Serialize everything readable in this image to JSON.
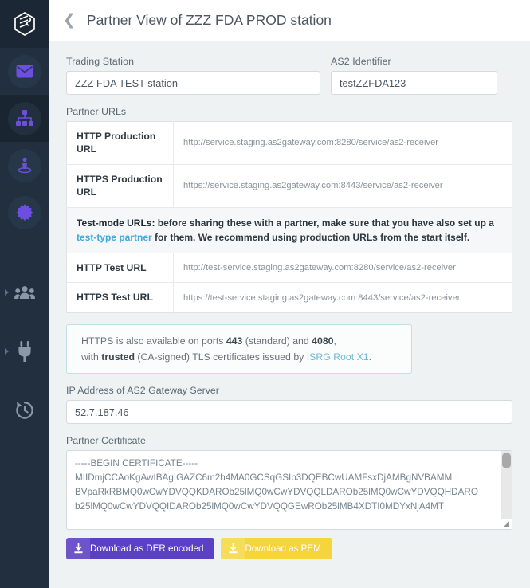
{
  "app": {
    "logo_icon": "cube-logo-icon"
  },
  "sidebar": {
    "items": [
      {
        "icon": "envelope-icon",
        "name": "messages",
        "active": false
      },
      {
        "icon": "sitemap-icon",
        "name": "trading-stations",
        "active": true
      },
      {
        "icon": "person-pedestal-icon",
        "name": "partners",
        "active": false
      },
      {
        "icon": "badge-star-icon",
        "name": "certificates",
        "active": false
      }
    ],
    "lower_items": [
      {
        "icon": "users-group-icon",
        "name": "users",
        "expandable": true
      },
      {
        "icon": "plug-icon",
        "name": "integrations",
        "expandable": true
      },
      {
        "icon": "history-clock-icon",
        "name": "history",
        "expandable": false
      }
    ]
  },
  "header": {
    "back_icon": "chevron-left-icon",
    "title": "Partner View of ZZZ FDA PROD station"
  },
  "form": {
    "trading_station": {
      "label": "Trading Station",
      "value": "ZZZ FDA TEST station"
    },
    "as2_identifier": {
      "label": "AS2 Identifier",
      "value": "testZZFDA123"
    },
    "partner_urls_label": "Partner URLs",
    "ip_address": {
      "label": "IP Address of AS2 Gateway Server",
      "value": "52.7.187.46"
    },
    "partner_certificate": {
      "label": "Partner Certificate",
      "value": "-----BEGIN CERTIFICATE-----\nMIIDmjCCAoKgAwIBAgIGAZC6m2h4MA0GCSqGSIb3DQEBCwUAMFsxDjAMBgNVBAMM\nBVpaRkRBMQ0wCwYDVQQKDAROb25lMQ0wCwYDVQQLDAROb25lMQ0wCwYDVQQHDARO\nb25lMQ0wCwYDVQQIDAROb25lMQ0wCwYDVQQGEwROb25lMB4XDTI0MDYxNjA4MT"
    }
  },
  "url_table": {
    "rows": [
      {
        "key": "HTTP Production URL",
        "value": "http://service.staging.as2gateway.com:8280/service/as2-receiver"
      },
      {
        "key": "HTTPS Production URL",
        "value": "https://service.staging.as2gateway.com:8443/service/as2-receiver"
      },
      {
        "key": "HTTP Test URL",
        "value": "http://test-service.staging.as2gateway.com:8280/service/as2-receiver"
      },
      {
        "key": "HTTPS Test URL",
        "value": "https://test-service.staging.as2gateway.com:8443/service/as2-receiver"
      }
    ],
    "warning": {
      "lead": "Test-mode URLs:",
      "text_before_link": " before sharing these with a partner, make sure that you have also set up a ",
      "link": "test-type partner",
      "text_after_link": " for them. We recommend using production URLs from the start itself."
    }
  },
  "info_box": {
    "line1_a": "HTTPS is also available on ports ",
    "port_standard": "443",
    "line1_b": " (standard) and ",
    "port_alt": "4080",
    "line1_c": ",",
    "line2_a": "with ",
    "trusted": "trusted",
    "line2_b": " (CA-signed) TLS certificates issued by ",
    "ca_link": "ISRG Root X1",
    "line2_c": "."
  },
  "buttons": {
    "der": {
      "label": "Download as DER encoded",
      "icon": "download-icon",
      "color": "#5b3fc4"
    },
    "pem": {
      "label": "Download as PEM",
      "icon": "download-icon",
      "color": "#f6d43c"
    }
  }
}
